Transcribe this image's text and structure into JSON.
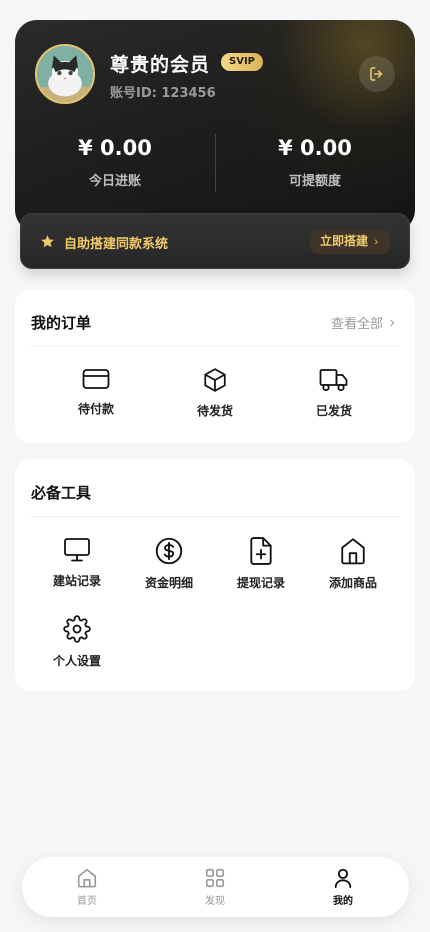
{
  "member": {
    "name": "尊贵的会员",
    "badge": "SVIP",
    "account_id": "账号ID: 123456",
    "today_income_value": "¥ 0.00",
    "today_income_label": "今日进账",
    "withdrawable_value": "¥ 0.00",
    "withdrawable_label": "可提额度"
  },
  "promo": {
    "text": "自助搭建同款系统",
    "button_label": "立即搭建"
  },
  "orders": {
    "title": "我的订单",
    "view_all": "查看全部",
    "items": [
      {
        "label": "待付款",
        "icon": "credit-card-icon"
      },
      {
        "label": "待发货",
        "icon": "package-icon"
      },
      {
        "label": "已发货",
        "icon": "truck-icon"
      }
    ]
  },
  "tools": {
    "title": "必备工具",
    "items": [
      {
        "label": "建站记录",
        "icon": "monitor-icon"
      },
      {
        "label": "资金明细",
        "icon": "dollar-circle-icon"
      },
      {
        "label": "提现记录",
        "icon": "file-plus-icon"
      },
      {
        "label": "添加商品",
        "icon": "home-icon"
      },
      {
        "label": "个人设置",
        "icon": "gear-icon"
      }
    ]
  },
  "nav": {
    "items": [
      {
        "label": "首页",
        "icon": "home-icon",
        "active": false
      },
      {
        "label": "发现",
        "icon": "grid-icon",
        "active": false
      },
      {
        "label": "我的",
        "icon": "user-icon",
        "active": true
      }
    ]
  },
  "colors": {
    "gold": "#f0c96a",
    "card_dark": "#1e1e1e",
    "background": "#f5f6f8"
  }
}
